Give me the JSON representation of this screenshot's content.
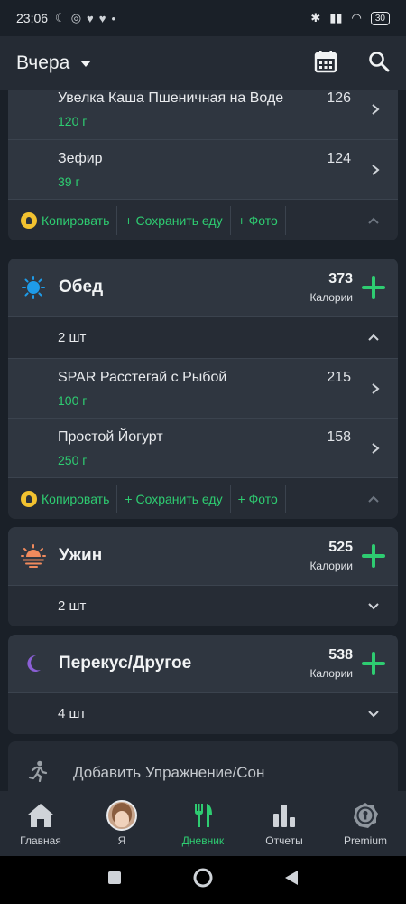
{
  "status_bar": {
    "time": "23:06",
    "battery": "30"
  },
  "app_bar": {
    "day": "Вчера"
  },
  "top_card": {
    "foods": [
      {
        "name": "Увелка Каша Пшеничная на Воде",
        "qty": "120 г",
        "cal": "126"
      },
      {
        "name": "Зефир",
        "qty": "39 г",
        "cal": "124"
      }
    ],
    "actions": {
      "copy": "Копировать",
      "save": "+ Сохранить еду",
      "photo": "+ Фото"
    }
  },
  "lunch": {
    "name": "Обед",
    "calories": "373",
    "cal_label": "Калории",
    "count": "2 шт",
    "foods": [
      {
        "name": "SPAR Расстегай с Рыбой",
        "qty": "100 г",
        "cal": "215"
      },
      {
        "name": "Простой Йогурт",
        "qty": "250 г",
        "cal": "158"
      }
    ],
    "actions": {
      "copy": "Копировать",
      "save": "+ Сохранить еду",
      "photo": "+ Фото"
    }
  },
  "dinner": {
    "name": "Ужин",
    "calories": "525",
    "cal_label": "Калории",
    "count": "2 шт"
  },
  "snack": {
    "name": "Перекус/Другое",
    "calories": "538",
    "cal_label": "Калории",
    "count": "4 шт"
  },
  "add_exercise": {
    "label": "Добавить Упражнение/Сон"
  },
  "bottom_nav": {
    "home": "Главная",
    "me": "Я",
    "diary": "Дневник",
    "reports": "Отчеты",
    "premium": "Premium"
  },
  "colors": {
    "accent": "#2ecc71",
    "background": "#1a2028",
    "card": "#2b323c",
    "premium": "#f2c230"
  }
}
